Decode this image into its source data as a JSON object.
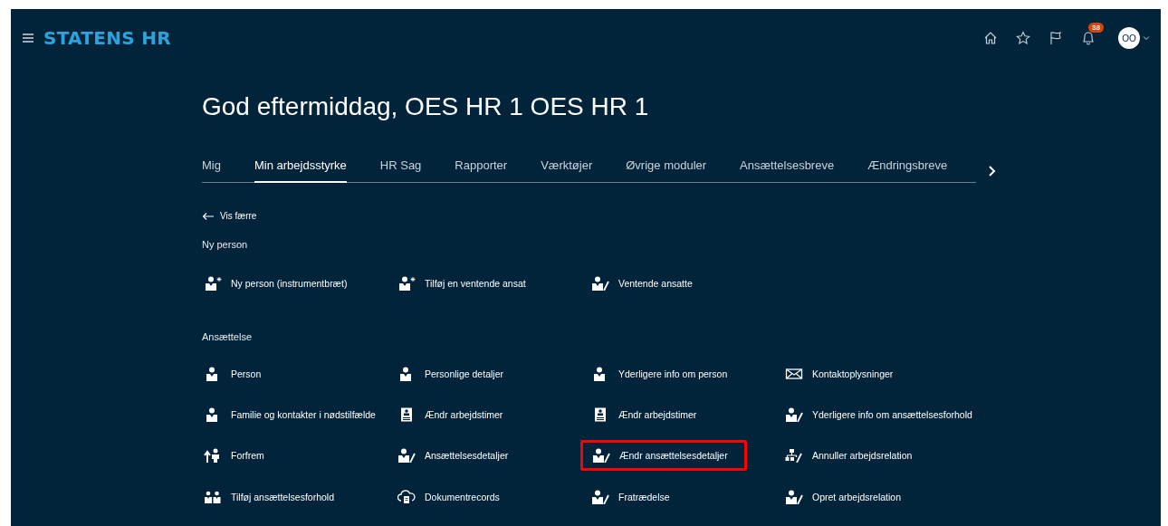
{
  "header": {
    "logo": "STATENS HR",
    "notification_count": "38",
    "avatar_initials": "OO"
  },
  "greeting": "God eftermiddag, OES HR 1 OES HR 1",
  "tabs": [
    {
      "label": "Mig",
      "selected": false
    },
    {
      "label": "Min arbejdsstyrke",
      "selected": true
    },
    {
      "label": "HR Sag",
      "selected": false
    },
    {
      "label": "Rapporter",
      "selected": false
    },
    {
      "label": "Værktøjer",
      "selected": false
    },
    {
      "label": "Øvrige moduler",
      "selected": false
    },
    {
      "label": "Ansættelsesbreve",
      "selected": false
    },
    {
      "label": "Ændringsbreve",
      "selected": false
    }
  ],
  "back_link": "Vis færre",
  "sections": [
    {
      "title": "Ny person",
      "items": [
        {
          "label": "Ny person (instrumentbræt)",
          "kind": "person-plus",
          "highlighted": false
        },
        {
          "label": "Tilføj en ventende ansat",
          "kind": "person-plus",
          "highlighted": false
        },
        {
          "label": "Ventende ansatte",
          "kind": "person-edit",
          "highlighted": false
        }
      ]
    },
    {
      "title": "Ansættelse",
      "items": [
        {
          "label": "Person",
          "kind": "person",
          "highlighted": false
        },
        {
          "label": "Personlige detaljer",
          "kind": "person",
          "highlighted": false
        },
        {
          "label": "Yderligere info om person",
          "kind": "person",
          "highlighted": false
        },
        {
          "label": "Kontaktoplysninger",
          "kind": "envelope",
          "highlighted": false
        },
        {
          "label": "Familie og kontakter i nødstilfælde",
          "kind": "person",
          "highlighted": false
        },
        {
          "label": "Ændr arbejdstimer",
          "kind": "card",
          "highlighted": false
        },
        {
          "label": "Ændr arbejdstimer",
          "kind": "card",
          "highlighted": false
        },
        {
          "label": "Yderligere info om ansættelsesforhold",
          "kind": "person-edit",
          "highlighted": false
        },
        {
          "label": "Forfrem",
          "kind": "promote",
          "highlighted": false
        },
        {
          "label": "Ansættelsesdetaljer",
          "kind": "person-edit",
          "highlighted": false
        },
        {
          "label": "Ændr ansættelsesdetaljer",
          "kind": "person-edit",
          "highlighted": true
        },
        {
          "label": "Annuller arbejdsrelation",
          "kind": "hierarchy",
          "highlighted": false
        },
        {
          "label": "Tilføj ansættelsesforhold",
          "kind": "people",
          "highlighted": false
        },
        {
          "label": "Dokumentrecords",
          "kind": "cloud",
          "highlighted": false
        },
        {
          "label": "Fratrædelse",
          "kind": "person-edit",
          "highlighted": false
        },
        {
          "label": "Opret arbejdsrelation",
          "kind": "person-edit",
          "highlighted": false
        }
      ]
    }
  ]
}
